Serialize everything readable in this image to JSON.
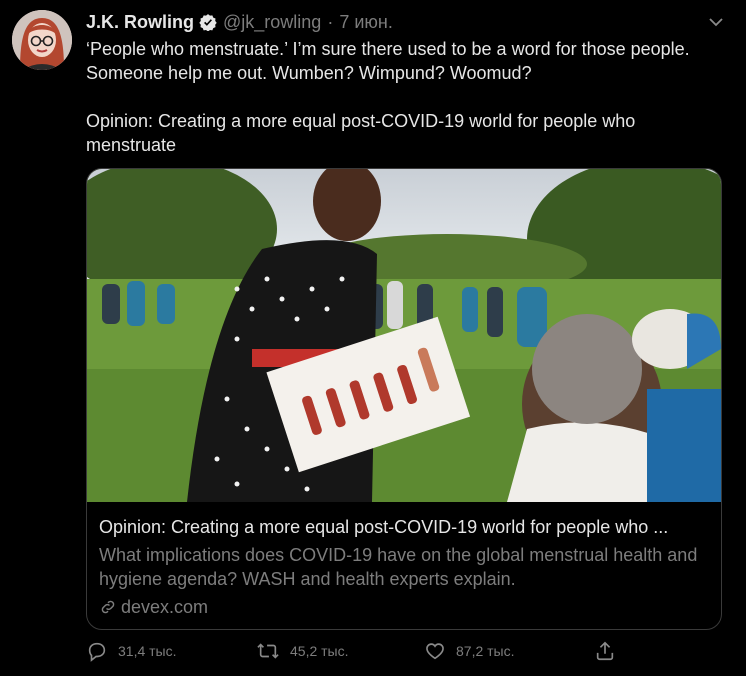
{
  "author": {
    "name": "J.K. Rowling",
    "handle": "@jk_rowling",
    "separator": "·",
    "date": "7 июн."
  },
  "tweet": {
    "text": "‘People who menstruate.’ I’m sure there used to be a word for those people. Someone help me out. Wumben? Wimpund? Woomud?\n\nOpinion: Creating a more equal post-COVID-19 world for people who menstruate"
  },
  "card": {
    "title": "Opinion: Creating a more equal post-COVID-19 world for people who ...",
    "description": "What implications does COVID-19 have on the global menstrual health and hygiene agenda? WASH and health experts explain.",
    "domain": "devex.com"
  },
  "actions": {
    "replies": "31,4 тыс.",
    "retweets": "45,2 тыс.",
    "likes": "87,2 тыс."
  },
  "colors": {
    "background": "#000000",
    "text": "#e6e6e6",
    "muted": "#7d7d7d",
    "border": "#3a3a3a"
  }
}
